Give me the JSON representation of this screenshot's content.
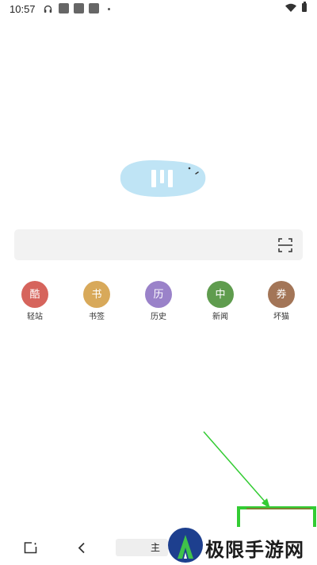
{
  "status_bar": {
    "time": "10:57",
    "icons": [
      "headset-icon",
      "app-notification-icon",
      "app-notification-icon",
      "app-notification-icon",
      "more-notifications-dot",
      "wifi-icon",
      "battery-icon"
    ]
  },
  "logo": {
    "icon": "browser-logo",
    "color": "#bfe4f5"
  },
  "search": {
    "placeholder": "",
    "scan_icon": "scan-icon"
  },
  "shortcuts": [
    {
      "glyph": "酷",
      "label": "轻站",
      "color": "#d6645c"
    },
    {
      "glyph": "书",
      "label": "书签",
      "color": "#d8a95a"
    },
    {
      "glyph": "历",
      "label": "历史",
      "color": "#9a82c9"
    },
    {
      "glyph": "中",
      "label": "新闻",
      "color": "#5f9c4e"
    },
    {
      "glyph": "券",
      "label": "坏猫",
      "color": "#a37557"
    }
  ],
  "bottom_nav": {
    "tabs_icon": "tabs-icon",
    "back_icon": "back-arrow-icon",
    "home_label": "主"
  },
  "annotation": {
    "color": "#33cc33"
  },
  "watermark": {
    "text": "极限手游网"
  }
}
